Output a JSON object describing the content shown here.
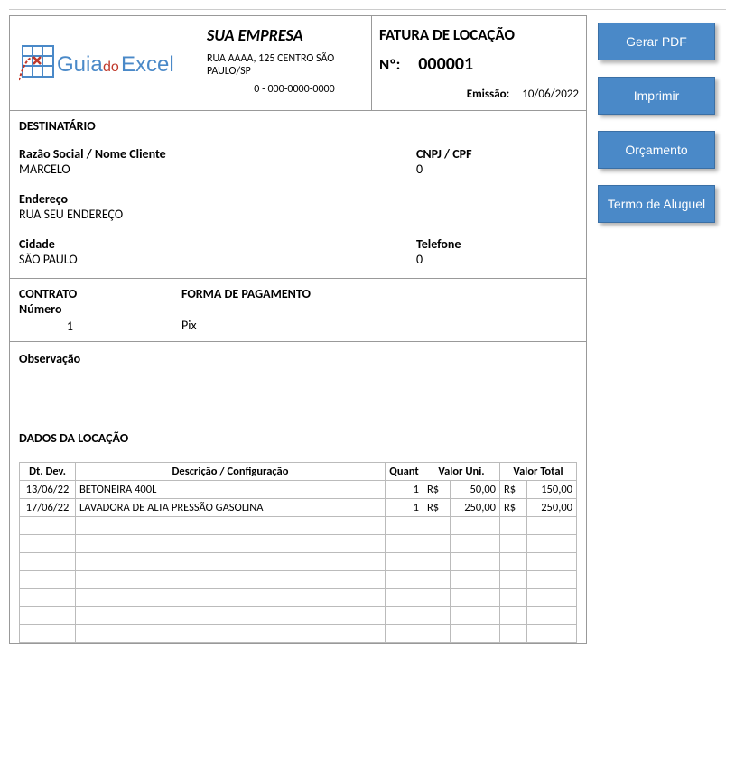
{
  "buttons": {
    "pdf": "Gerar PDF",
    "print": "Imprimir",
    "budget": "Orçamento",
    "lease": "Termo de Aluguel"
  },
  "company": {
    "name": "SUA EMPRESA",
    "address": "RUA AAAA, 125 CENTRO SÃO PAULO/SP",
    "id": "0 - 000-0000-0000"
  },
  "invoice": {
    "title": "FATURA DE LOCAÇÃO",
    "num_label": "Nº:",
    "num_value": "000001",
    "emission_label": "Emissão:",
    "emission_value": "10/06/2022"
  },
  "recipient": {
    "section": "DESTINATÁRIO",
    "name_label": "Razão Social / Nome Cliente",
    "name_value": "MARCELO",
    "doc_label": "CNPJ / CPF",
    "doc_value": "0",
    "addr_label": "Endereço",
    "addr_value": "RUA SEU ENDEREÇO",
    "city_label": "Cidade",
    "city_value": "SÃO PAULO",
    "phone_label": "Telefone",
    "phone_value": "0"
  },
  "contract": {
    "title": "CONTRATO",
    "num_label": "Número",
    "num_value": "1",
    "payment_title": "FORMA DE PAGAMENTO",
    "payment_value": "Pix"
  },
  "obs": {
    "label": "Observação"
  },
  "locacao": {
    "section": "DADOS DA LOCAÇÃO",
    "headers": {
      "date": "Dt. Dev.",
      "desc": "Descrição / Configuração",
      "qty": "Quant",
      "unit": "Valor Uni.",
      "total": "Valor Total"
    },
    "rows": [
      {
        "date": "13/06/22",
        "desc": "BETONEIRA 400L",
        "qty": "1",
        "cur": "R$",
        "unit": "50,00",
        "curt": "R$",
        "total": "150,00"
      },
      {
        "date": "17/06/22",
        "desc": "LAVADORA DE ALTA PRESSÃO GASOLINA",
        "qty": "1",
        "cur": "R$",
        "unit": "250,00",
        "curt": "R$",
        "total": "250,00"
      }
    ],
    "empty_rows": 7
  },
  "logo": {
    "text_guia": "Guia",
    "text_do": "do",
    "text_excel": "Excel"
  }
}
